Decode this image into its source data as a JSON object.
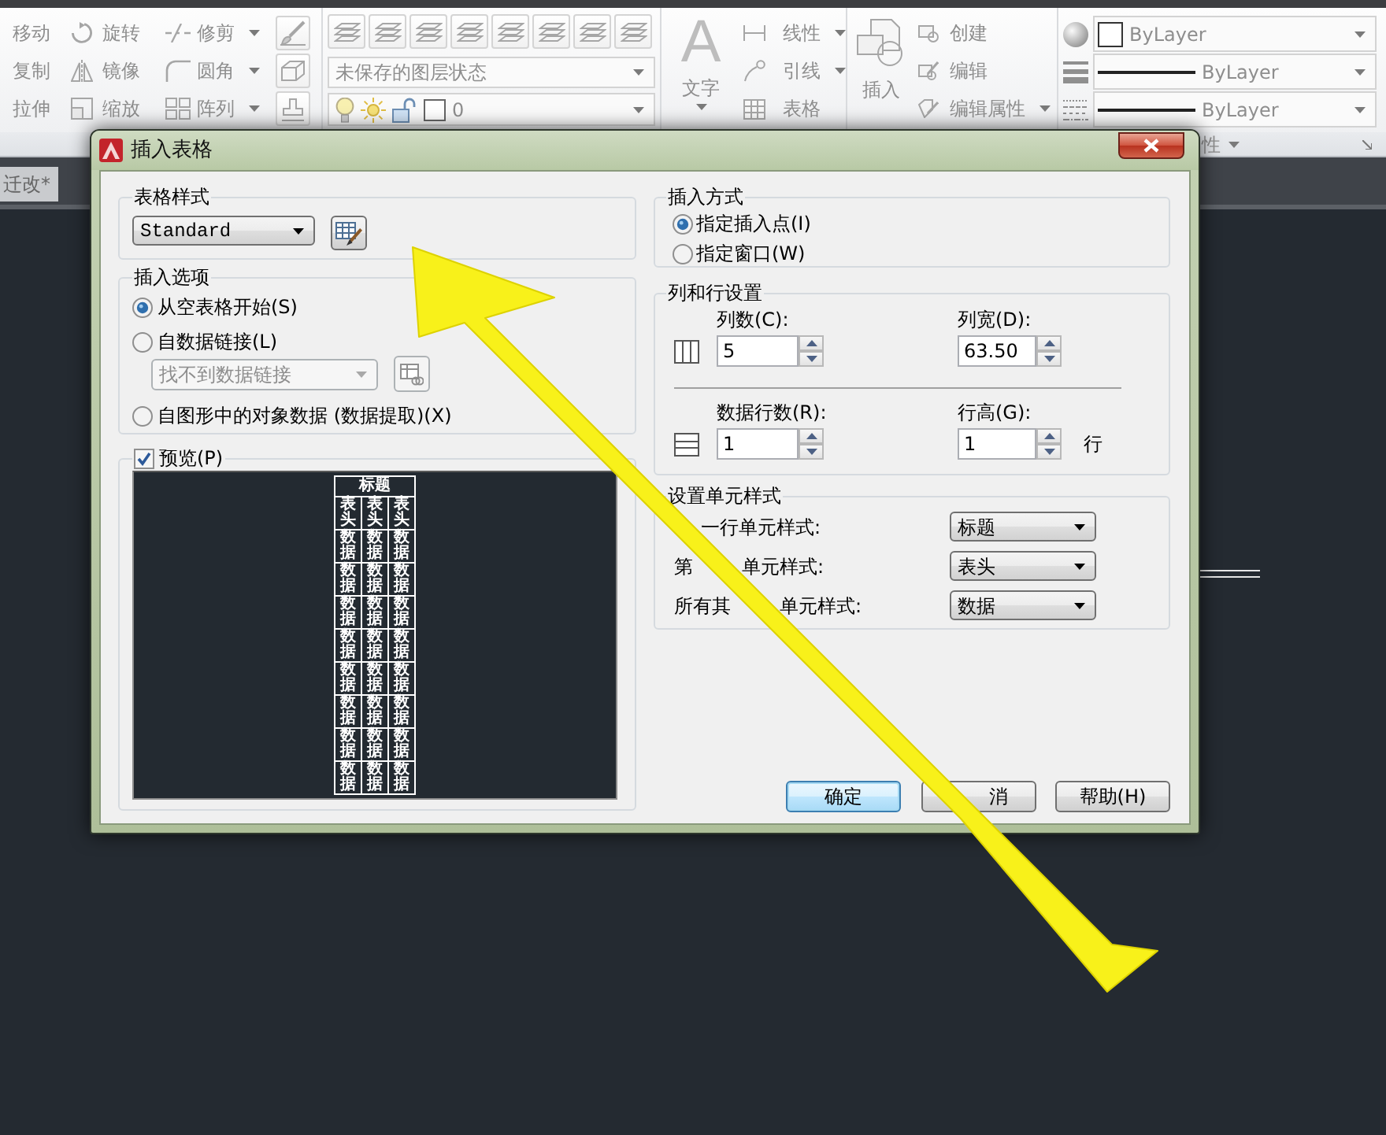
{
  "ribbon": {
    "modify_tools": [
      {
        "label": "移动",
        "dropdown": false
      },
      {
        "label": "旋转",
        "dropdown": false
      },
      {
        "label": "修剪",
        "dropdown": true
      },
      {
        "label": "复制",
        "dropdown": false
      },
      {
        "label": "镜像",
        "dropdown": false
      },
      {
        "label": "圆角",
        "dropdown": true
      },
      {
        "label": "拉伸",
        "dropdown": false
      },
      {
        "label": "缩放",
        "dropdown": false
      },
      {
        "label": "阵列",
        "dropdown": true
      }
    ],
    "layer_state": "未保存的图层状态",
    "current_layer": "0",
    "text_tool": {
      "glyph": "A",
      "label": "文字"
    },
    "annotation_tools": [
      {
        "label": "线性",
        "dropdown": true
      },
      {
        "label": "引线",
        "dropdown": true
      },
      {
        "label": "表格",
        "dropdown": false
      }
    ],
    "insert_tool": {
      "label": "插入"
    },
    "block_tools": [
      {
        "label": "创建",
        "dropdown": false
      },
      {
        "label": "编辑",
        "dropdown": false
      },
      {
        "label": "编辑属性",
        "dropdown": true
      }
    ],
    "properties": [
      {
        "kind": "color",
        "value": "ByLayer"
      },
      {
        "kind": "lineweight",
        "value": "ByLayer"
      },
      {
        "kind": "linetype",
        "value": "ByLayer"
      }
    ],
    "panel_title": "性"
  },
  "document_tab": "迁改*",
  "dialog": {
    "title": "插入表格",
    "table_style": {
      "heading": "表格样式",
      "value": "Standard"
    },
    "insert_options": {
      "heading": "插入选项",
      "options": [
        {
          "label": "从空表格开始(S)",
          "selected": true
        },
        {
          "label": "自数据链接(L)",
          "selected": false,
          "link": {
            "value": "找不到数据链接",
            "disabled": true
          }
        },
        {
          "label": "自图形中的对象数据 (数据提取)(X)",
          "selected": false
        }
      ]
    },
    "preview": {
      "label": "预览(P)",
      "checked": true,
      "table": {
        "title": "标题",
        "header": [
          "表头",
          "表头",
          "表头"
        ],
        "rows": [
          [
            "数据",
            "数据",
            "数据"
          ],
          [
            "数据",
            "数据",
            "数据"
          ],
          [
            "数据",
            "数据",
            "数据"
          ],
          [
            "数据",
            "数据",
            "数据"
          ],
          [
            "数据",
            "数据",
            "数据"
          ],
          [
            "数据",
            "数据",
            "数据"
          ],
          [
            "数据",
            "数据",
            "数据"
          ],
          [
            "数据",
            "数据",
            "数据"
          ]
        ]
      }
    },
    "insertion": {
      "heading": "插入方式",
      "options": [
        {
          "label": "指定插入点(I)",
          "selected": true
        },
        {
          "label": "指定窗口(W)",
          "selected": false
        }
      ]
    },
    "size": {
      "heading": "列和行设置",
      "blocks": [
        {
          "kind": "columns",
          "fields": [
            {
              "label": "列数(C):",
              "value": "5"
            },
            {
              "label": "列宽(D):",
              "value": "63.50"
            }
          ]
        },
        {
          "kind": "rows",
          "fields": [
            {
              "label": "数据行数(R):",
              "value": "1"
            },
            {
              "label": "行高(G):",
              "value": "1"
            }
          ],
          "unit": "行"
        }
      ]
    },
    "cell_styles": {
      "heading": "设置单元样式",
      "rows": [
        {
          "label_parts": [
            "一行单元样式:"
          ],
          "value": "标题"
        },
        {
          "label_parts": [
            "第",
            "单元样式:"
          ],
          "value": "表头"
        },
        {
          "label_parts": [
            "所有其",
            "单元样式:"
          ],
          "value": "数据"
        }
      ]
    },
    "buttons": [
      {
        "label": "确定",
        "default": true
      },
      {
        "label": "消",
        "default": false
      },
      {
        "label": "帮助(H)",
        "default": false
      }
    ]
  }
}
